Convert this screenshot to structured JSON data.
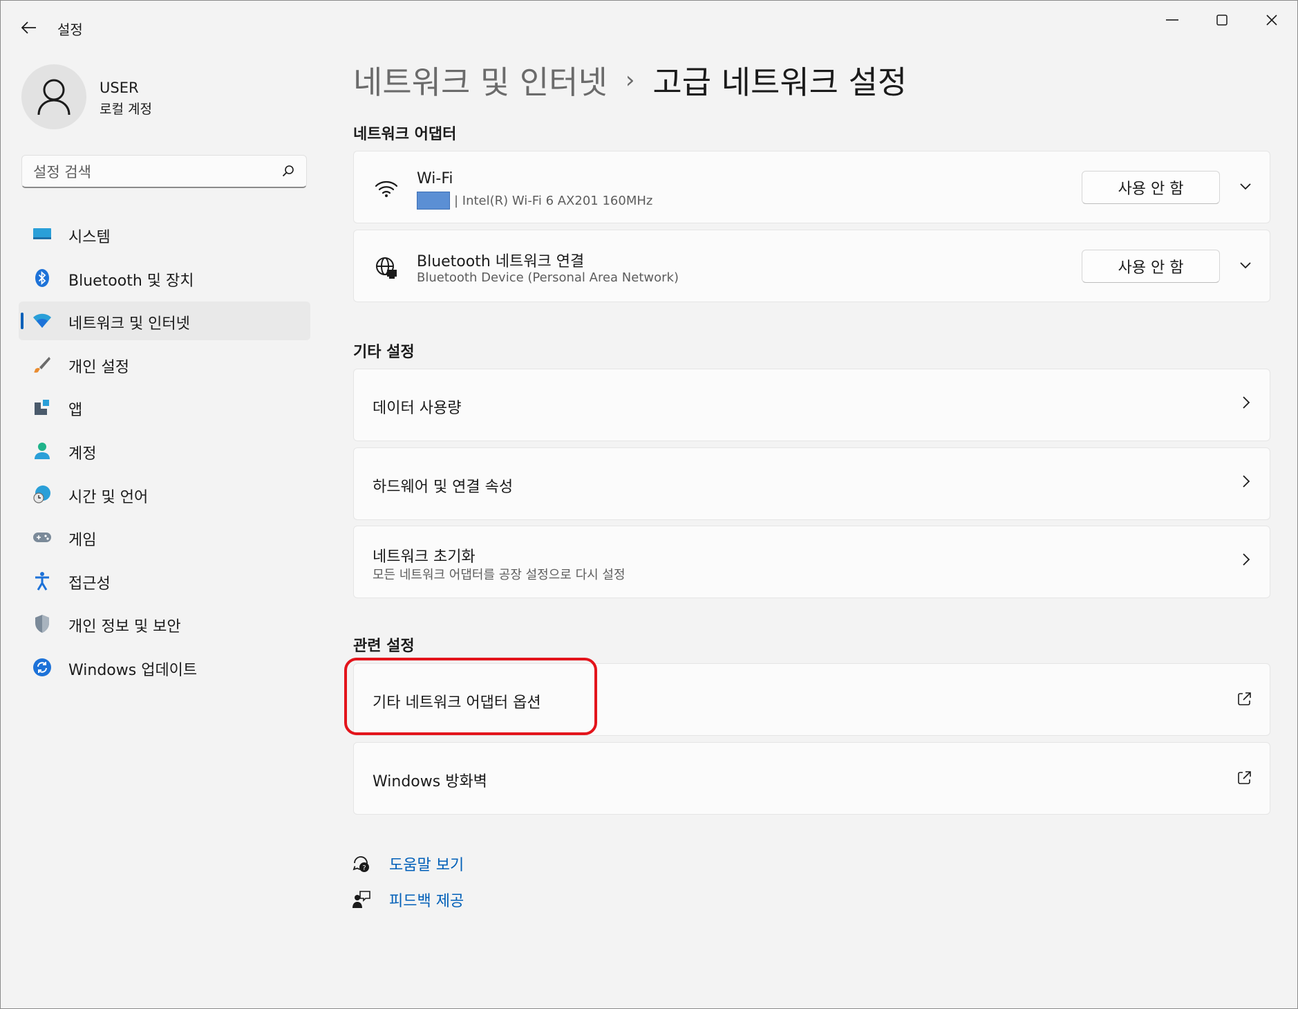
{
  "window": {
    "app_title": "설정"
  },
  "user": {
    "name": "USER",
    "account_type": "로컬 계정"
  },
  "search": {
    "placeholder": "설정 검색"
  },
  "sidebar": {
    "items": [
      {
        "label": "시스템",
        "icon": "system-icon"
      },
      {
        "label": "Bluetooth 및 장치",
        "icon": "bluetooth-icon"
      },
      {
        "label": "네트워크 및 인터넷",
        "icon": "wifi-icon",
        "active": true
      },
      {
        "label": "개인 설정",
        "icon": "brush-icon"
      },
      {
        "label": "앱",
        "icon": "apps-icon"
      },
      {
        "label": "계정",
        "icon": "account-icon"
      },
      {
        "label": "시간 및 언어",
        "icon": "time-language-icon"
      },
      {
        "label": "게임",
        "icon": "gamepad-icon"
      },
      {
        "label": "접근성",
        "icon": "accessibility-icon"
      },
      {
        "label": "개인 정보 및 보안",
        "icon": "shield-icon"
      },
      {
        "label": "Windows 업데이트",
        "icon": "update-icon"
      }
    ]
  },
  "breadcrumb": {
    "parent": "네트워크 및 인터넷",
    "separator": "›",
    "current": "고급 네트워크 설정"
  },
  "adapters": {
    "section_title": "네트워크 어댑터",
    "items": [
      {
        "name": "Wi-Fi",
        "detail": "| Intel(R) Wi-Fi 6 AX201 160MHz",
        "button": "사용 안 함",
        "icon": "wifi-icon"
      },
      {
        "name": "Bluetooth 네트워크 연결",
        "detail": "Bluetooth Device (Personal Area Network)",
        "button": "사용 안 함",
        "icon": "network-globe-icon"
      }
    ]
  },
  "other_settings": {
    "section_title": "기타 설정",
    "items": [
      {
        "title": "데이터 사용량"
      },
      {
        "title": "하드웨어 및 연결 속성"
      },
      {
        "title": "네트워크 초기화",
        "subtitle": "모든 네트워크 어댑터를 공장 설정으로 다시 설정"
      }
    ]
  },
  "related_settings": {
    "section_title": "관련 설정",
    "items": [
      {
        "title": "기타 네트워크 어댑터 옵션",
        "icon": "external-link-icon"
      },
      {
        "title": "Windows 방화벽",
        "icon": "external-link-icon"
      }
    ]
  },
  "help_links": {
    "help": "도움말 보기",
    "feedback": "피드백 제공"
  },
  "colors": {
    "accent": "#005fb8",
    "highlight": "#e3141b",
    "background": "#f3f3f3",
    "card": "#fbfbfb"
  }
}
